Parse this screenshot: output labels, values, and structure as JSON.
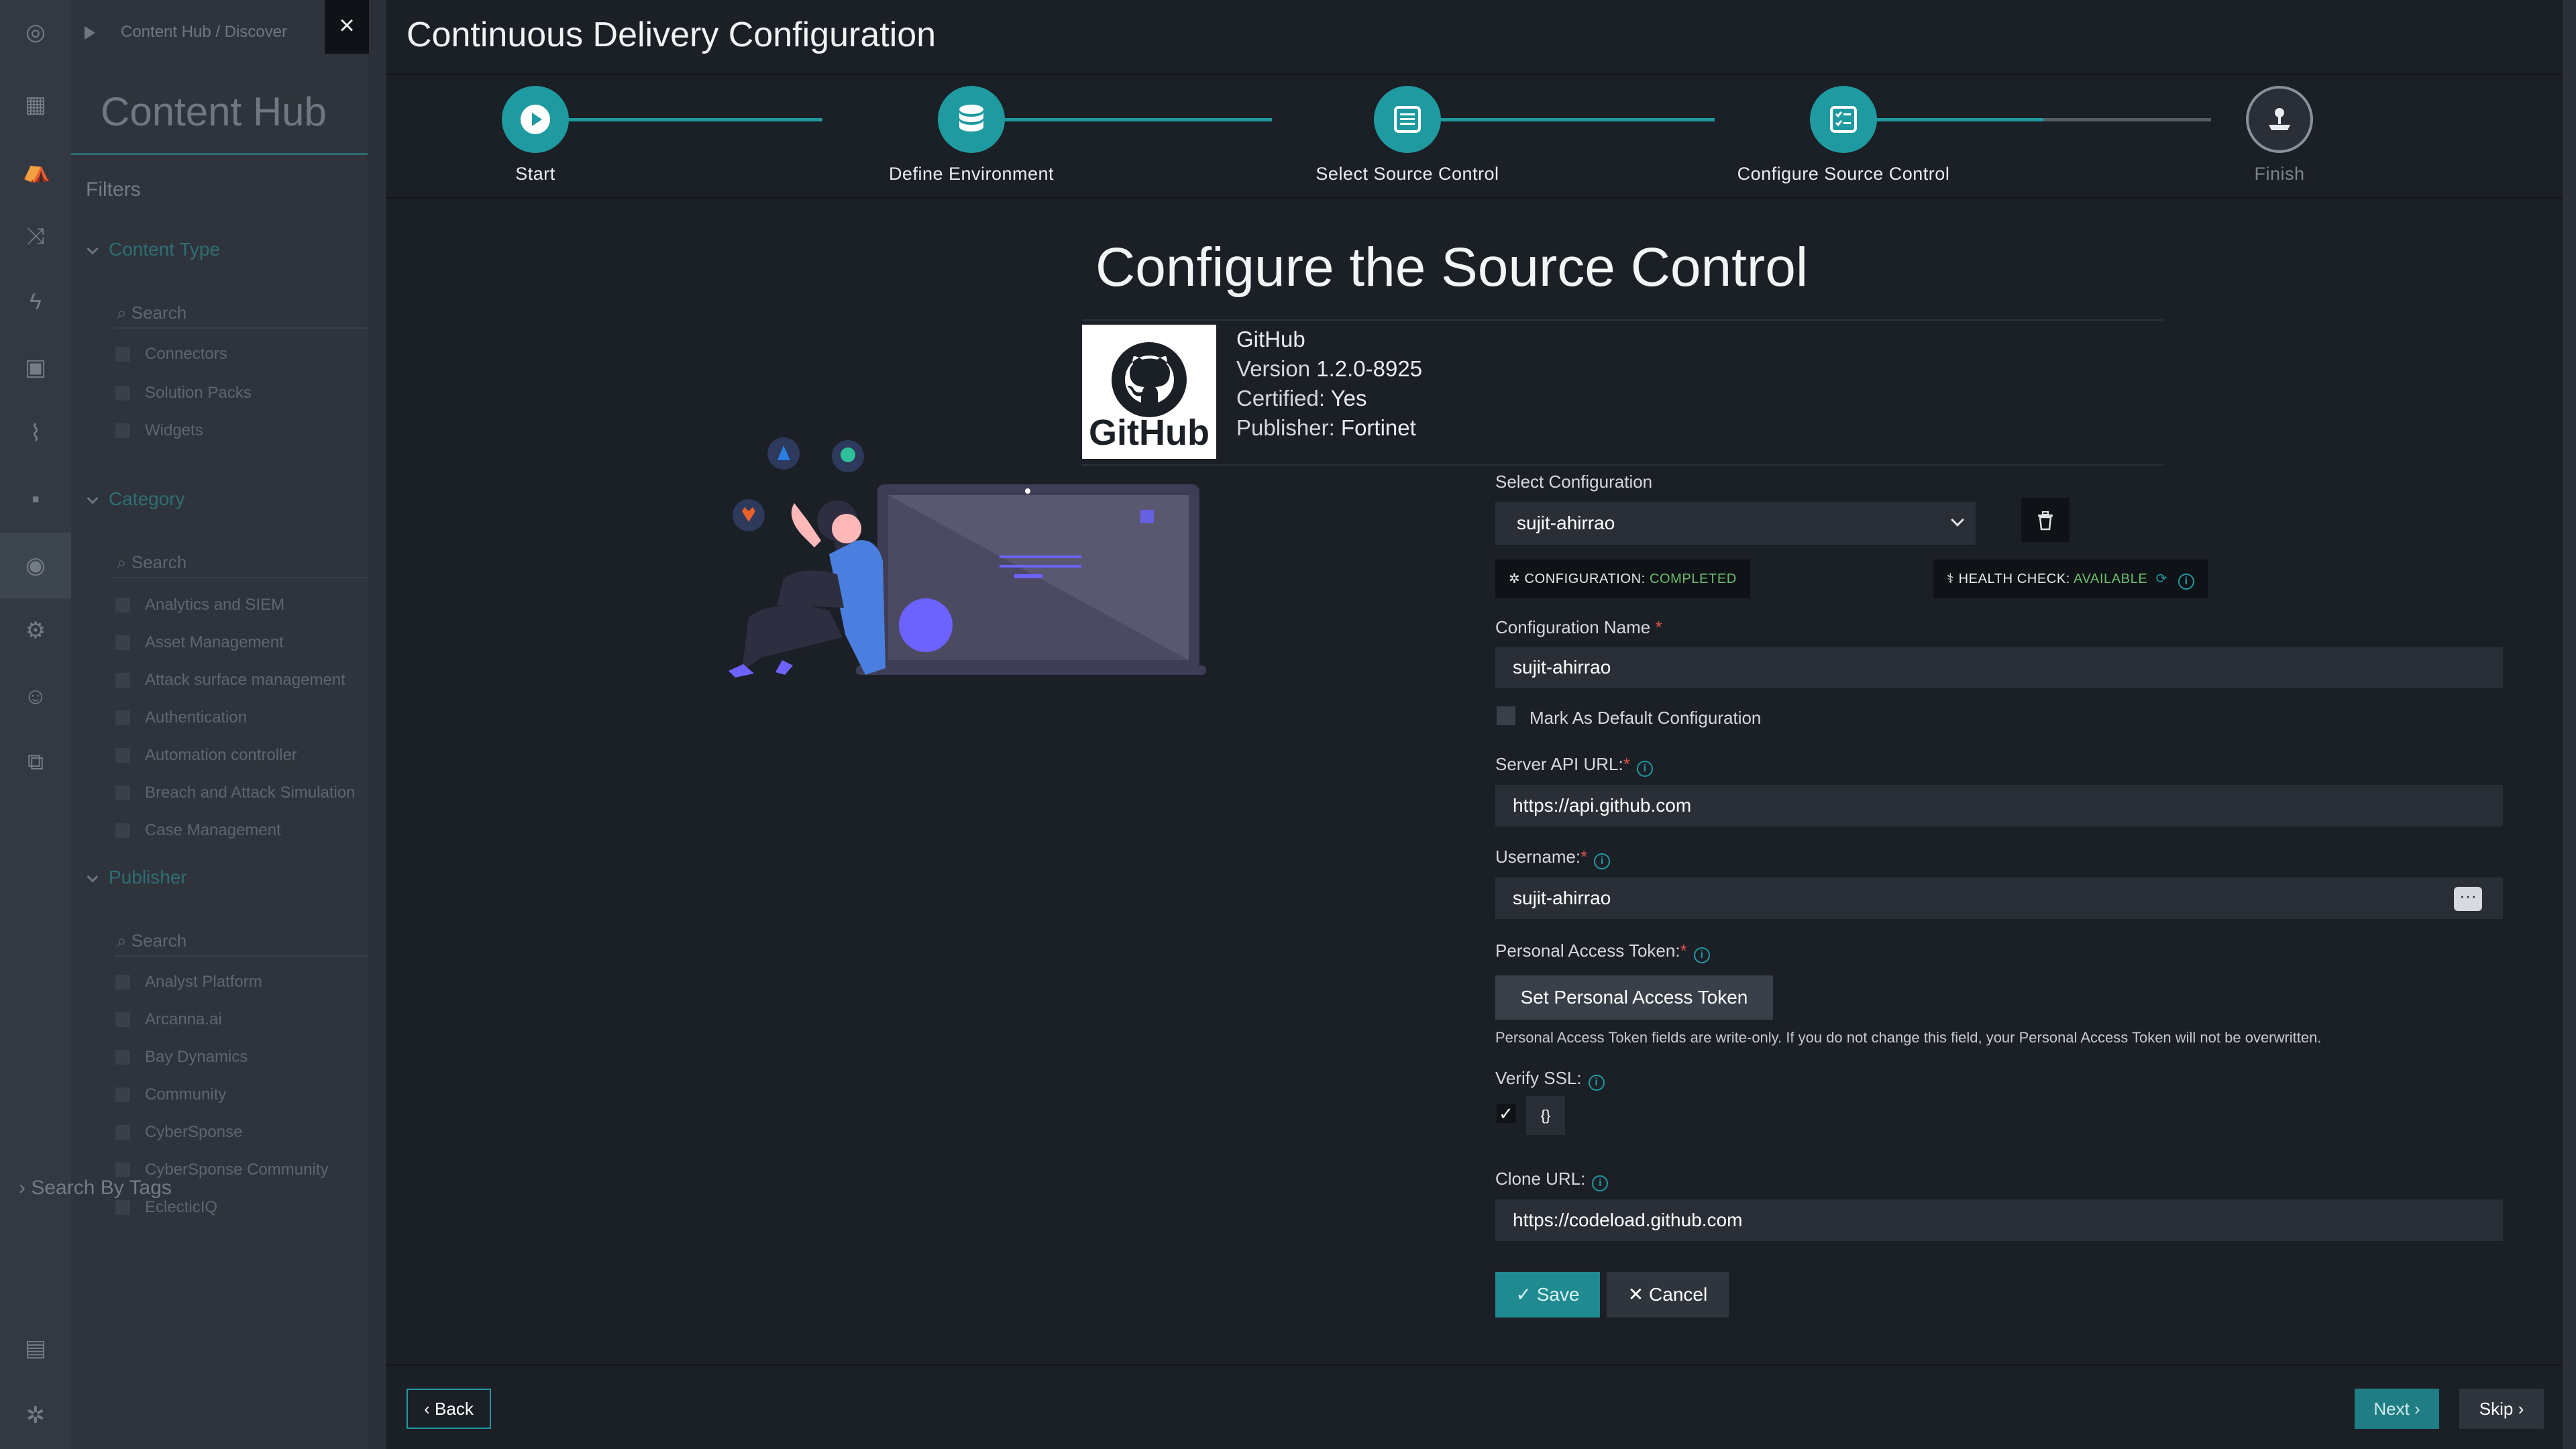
{
  "background": {
    "breadcrumb": "Content Hub  /  Discover",
    "panel_title": "Content Hub",
    "filters_label": "Filters",
    "sections": [
      {
        "title": "Content Type",
        "search_placeholder": "Search",
        "items": [
          "Connectors",
          "Solution Packs",
          "Widgets"
        ]
      },
      {
        "title": "Category",
        "search_placeholder": "Search",
        "items": [
          "Analytics and SIEM",
          "Asset Management",
          "Attack surface management",
          "Authentication",
          "Automation controller",
          "Breach and Attack Simulation",
          "Case Management"
        ]
      },
      {
        "title": "Publisher",
        "search_placeholder": "Search",
        "items": [
          "Analyst Platform",
          "Arcanna.ai",
          "Bay Dynamics",
          "Community",
          "CyberSponse",
          "CyberSponse Community",
          "EclecticIQ"
        ]
      }
    ],
    "search_by_tags": "Search By Tags",
    "rail_icons": [
      "settings-icon",
      "dashboard-icon",
      "incidents-icon",
      "shuffle-icon",
      "bolt-icon",
      "briefcase-icon",
      "chart-icon",
      "grid-icon",
      "content-hub-icon",
      "gear-icon",
      "users-icon",
      "workflow-icon",
      "clipboard-icon",
      "cog-icon"
    ]
  },
  "modal": {
    "close_icon": "×",
    "title": "Continuous Delivery Configuration",
    "steps": [
      {
        "label": "Start",
        "status": "done",
        "icon": "play-icon"
      },
      {
        "label": "Define Environment",
        "status": "done",
        "icon": "database-icon"
      },
      {
        "label": "Select Source Control",
        "status": "done",
        "icon": "list-icon"
      },
      {
        "label": "Configure Source Control",
        "status": "current",
        "icon": "checklist-icon"
      },
      {
        "label": "Finish",
        "status": "pending",
        "icon": "joystick-icon"
      }
    ],
    "form": {
      "title": "Configure the Source Control",
      "connector": {
        "logo_text": "GitHub",
        "name": "GitHub",
        "version_label": "Version",
        "version": "1.2.0-8925",
        "certified_label": "Certified:",
        "certified": "Yes",
        "publisher_label": "Publisher:",
        "publisher": "Fortinet"
      },
      "select_configuration_label": "Select Configuration",
      "select_configuration_value": "sujit-ahirrao",
      "config_badge_label": "CONFIGURATION:",
      "config_badge_value": "COMPLETED",
      "health_badge_label": "HEALTH CHECK:",
      "health_badge_value": "AVAILABLE",
      "configuration_name_label": "Configuration Name",
      "configuration_name_value": "sujit-ahirrao",
      "default_config_label": "Mark As Default Configuration",
      "default_config_checked": false,
      "server_api_url_label": "Server API URL:",
      "server_api_url_value": "https://api.github.com",
      "username_label": "Username:",
      "username_value": "sujit-ahirrao",
      "token_label": "Personal Access Token:",
      "token_button": "Set Personal Access Token",
      "token_note": "Personal Access Token fields are write-only. If you do not change this field, your Personal Access Token will not be overwritten.",
      "verify_ssl_label": "Verify SSL:",
      "verify_ssl_checked": true,
      "json_button": "{}",
      "clone_url_label": "Clone URL:",
      "clone_url_value": "https://codeload.github.com",
      "save_label": "Save",
      "cancel_label": "Cancel"
    },
    "footer": {
      "back_label": "Back",
      "next_label": "Next",
      "skip_label": "Skip"
    }
  },
  "colors": {
    "accent": "#1f9aa0",
    "success": "#6cc070",
    "required": "#d9534f",
    "illustration_purple": "#6c63ff",
    "illustration_blue": "#4a7fe0"
  }
}
